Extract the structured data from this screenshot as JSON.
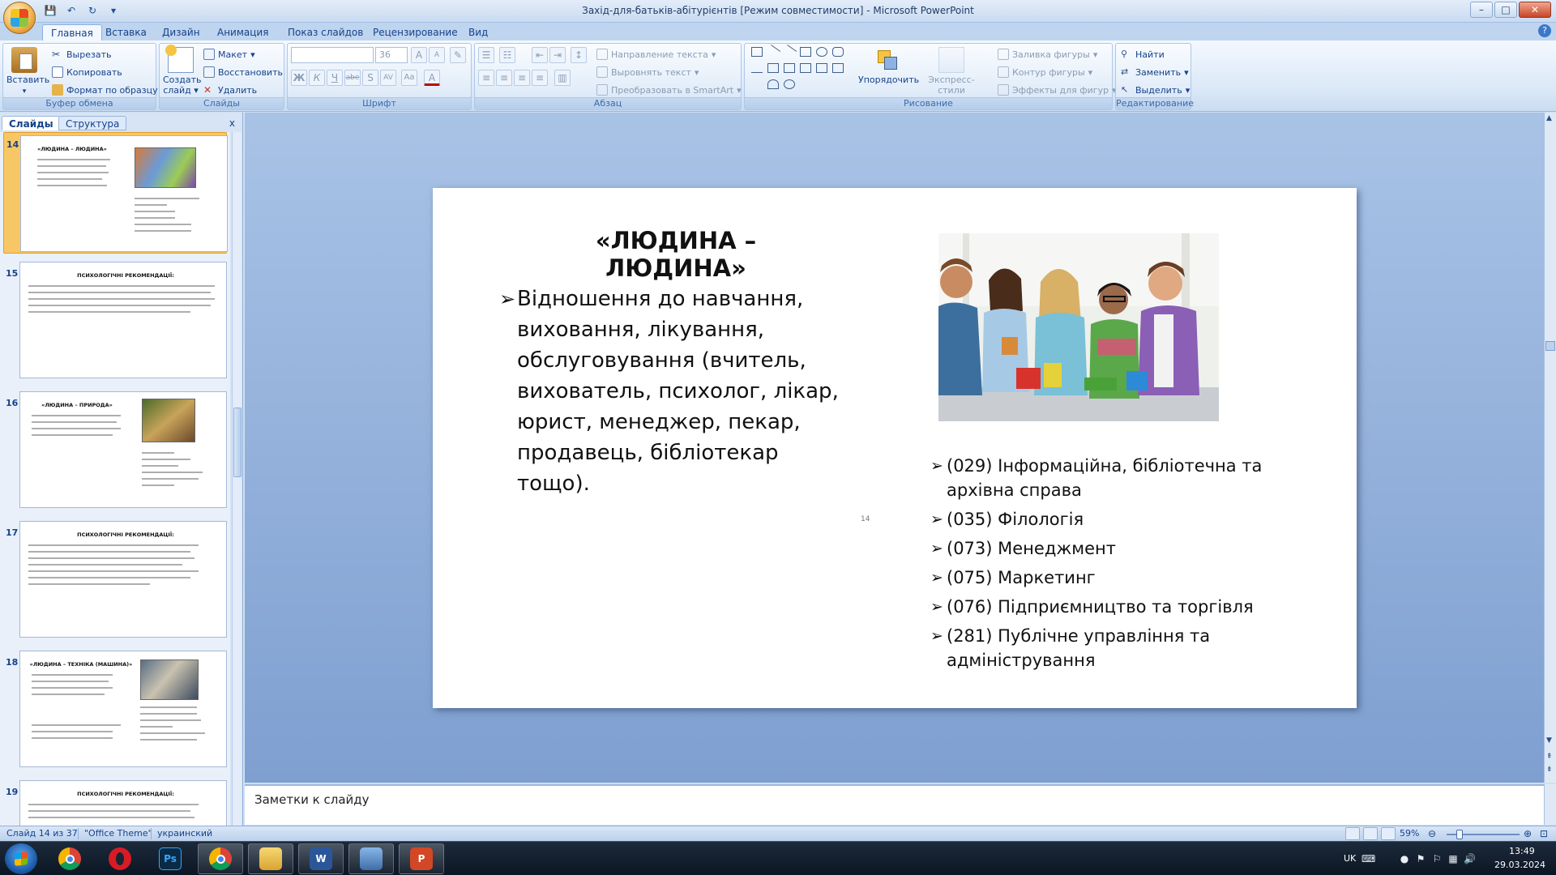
{
  "window": {
    "title": "Захід-для-батьків-абітурієнтів [Режим совместимости] - Microsoft PowerPoint",
    "controls": {
      "minimize": "–",
      "maximize": "□",
      "close": "✕"
    }
  },
  "ribbon_tabs": [
    "Главная",
    "Вставка",
    "Дизайн",
    "Анимация",
    "Показ слайдов",
    "Рецензирование",
    "Вид"
  ],
  "ribbon": {
    "clipboard": {
      "paste": "Вставить",
      "cut": "Вырезать",
      "copy": "Копировать",
      "format_painter": "Формат по образцу",
      "label": "Буфер обмена"
    },
    "slides": {
      "new_slide_1": "Создать",
      "new_slide_2": "слайд",
      "layout": "Макет",
      "reset": "Восстановить",
      "delete": "Удалить",
      "label": "Слайды"
    },
    "font": {
      "font_name": "",
      "font_size": "36",
      "label": "Шрифт",
      "bold": "Ж",
      "italic": "К",
      "underline": "Ч",
      "strike": "abe",
      "shadow": "S",
      "spacing": "AV",
      "case": "Aa",
      "color": "A",
      "grow": "A",
      "shrink": "A"
    },
    "paragraph": {
      "text_direction": "Направление текста",
      "align_text": "Выровнять текст",
      "smartart": "Преобразовать в SmartArt",
      "label": "Абзац"
    },
    "drawing": {
      "arrange": "Упорядочить",
      "quick_styles": "Экспресс-стили",
      "shape_fill": "Заливка фигуры",
      "shape_outline": "Контур фигуры",
      "shape_effects": "Эффекты для фигур",
      "label": "Рисование"
    },
    "editing": {
      "find": "Найти",
      "replace": "Заменить",
      "select": "Выделить",
      "label": "Редактирование"
    }
  },
  "panel": {
    "tabs": [
      "Слайды",
      "Структура"
    ],
    "close": "x",
    "thumbnails": [
      {
        "num": "14",
        "title": "«ЛЮДИНА – ЛЮДИНА»"
      },
      {
        "num": "15",
        "title": "ПСИХОЛОГІЧНІ РЕКОМЕНДАЦІЇ:"
      },
      {
        "num": "16",
        "title": "«ЛЮДИНА – ПРИРОДА»"
      },
      {
        "num": "17",
        "title": "ПСИХОЛОГІЧНІ РЕКОМЕНДАЦІЇ:"
      },
      {
        "num": "18",
        "title": "«ЛЮДИНА – ТЕХНІКА (МАШИНА)»"
      },
      {
        "num": "19",
        "title": "ПСИХОЛОГІЧНІ РЕКОМЕНДАЦІЇ:"
      }
    ]
  },
  "slide": {
    "title": "«ЛЮДИНА – ЛЮДИНА»",
    "body_lines": [
      "Відношення до навчання,",
      "виховання, лікування,",
      "обслуговування (вчитель,",
      "вихователь, психолог, лікар,",
      "юрист, менеджер, пекар,",
      "продавець, бібліотекар тощо)."
    ],
    "page_number": "14",
    "specialties": [
      "(029) Інформаційна, бібліотечна та архівна справа",
      "(035) Філологія",
      "(073) Менеджмент",
      "(075) Маркетинг",
      "(076) Підприємництво та  торгівля",
      "(281) Публічне управління та адміністрування"
    ]
  },
  "notes": {
    "placeholder": "Заметки к слайду"
  },
  "status": {
    "slide_info": "Слайд 14 из 37",
    "theme": "\"Office Theme\"",
    "language": "украинский",
    "zoom": "59%"
  },
  "taskbar": {
    "language": "UK",
    "time": "13:49",
    "date": "29.03.2024"
  },
  "colors": {
    "ribbon_text": "#15428b",
    "edit_bg": "#8aa9d6",
    "selected_thumb": "#f7c766"
  }
}
